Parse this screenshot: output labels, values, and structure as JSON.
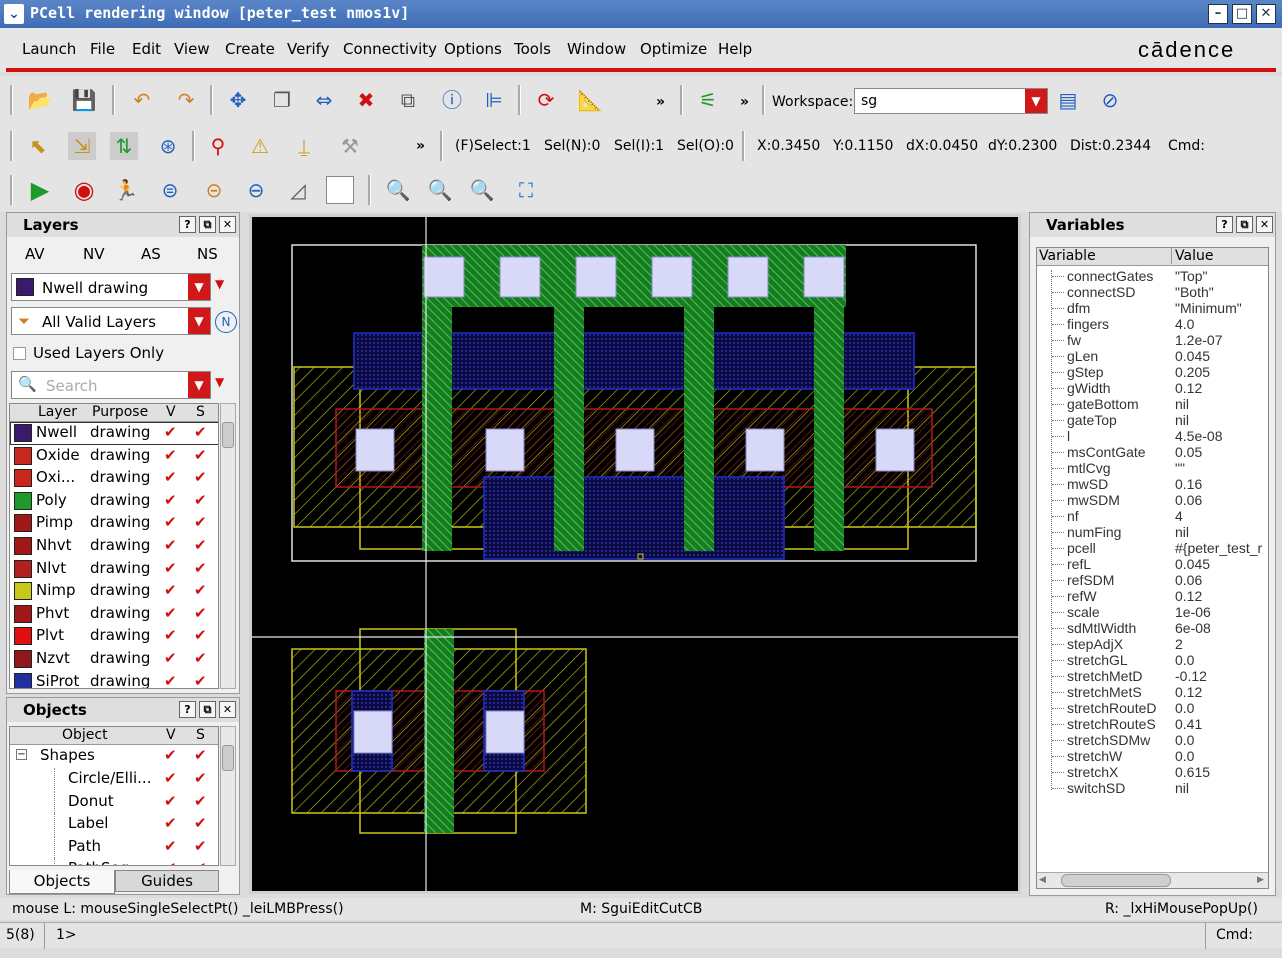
{
  "window": {
    "title": "PCell rendering window [peter_test nmos1v]"
  },
  "menu": [
    "Launch",
    "File",
    "Edit",
    "View",
    "Create",
    "Verify",
    "Connectivity",
    "Options",
    "Tools",
    "Window",
    "Optimize",
    "Help"
  ],
  "brand": "cādence",
  "toolbar": {
    "workspace_label": "Workspace:",
    "workspace_value": "sg",
    "more": "»"
  },
  "status_bar1": {
    "select": "(F)Select:1",
    "sel_n": "Sel(N):0",
    "sel_i": "Sel(I):1",
    "sel_o": "Sel(O):0",
    "x": "X:0.3450",
    "y": "Y:0.1150",
    "dx": "dX:0.0450",
    "dy": "dY:0.2300",
    "dist": "Dist:0.2344",
    "cmd": "Cmd:"
  },
  "layers_panel": {
    "title": "Layers",
    "tabs": [
      "AV",
      "NV",
      "AS",
      "NS"
    ],
    "layer_select": "Nwell drawing",
    "filter_select": "All Valid Layers",
    "used_only": "Used Layers Only",
    "search_placeholder": "Search",
    "columns": [
      "Layer",
      "Purpose",
      "V",
      "S"
    ],
    "rows": [
      {
        "layer": "Nwell",
        "purpose": "drawing",
        "color": "#3a1a6a"
      },
      {
        "layer": "Oxide",
        "purpose": "drawing",
        "color": "#c8281c"
      },
      {
        "layer": "Oxi...",
        "purpose": "drawing",
        "color": "#c8281c"
      },
      {
        "layer": "Poly",
        "purpose": "drawing",
        "color": "#1e9a2a"
      },
      {
        "layer": "Pimp",
        "purpose": "drawing",
        "color": "#a01818"
      },
      {
        "layer": "Nhvt",
        "purpose": "drawing",
        "color": "#a01818"
      },
      {
        "layer": "Nlvt",
        "purpose": "drawing",
        "color": "#b02020"
      },
      {
        "layer": "Nimp",
        "purpose": "drawing",
        "color": "#c8c818"
      },
      {
        "layer": "Phvt",
        "purpose": "drawing",
        "color": "#a01818"
      },
      {
        "layer": "Plvt",
        "purpose": "drawing",
        "color": "#e01010"
      },
      {
        "layer": "Nzvt",
        "purpose": "drawing",
        "color": "#901818"
      },
      {
        "layer": "SiProt",
        "purpose": "drawing",
        "color": "#2030a0"
      }
    ],
    "check": "✔"
  },
  "objects_panel": {
    "title": "Objects",
    "columns": [
      "Object",
      "V",
      "S"
    ],
    "root": "Shapes",
    "items": [
      "Circle/Elli...",
      "Donut",
      "Label",
      "Path",
      "PathSeg"
    ],
    "tabs": [
      "Objects",
      "Guides"
    ]
  },
  "variables_panel": {
    "title": "Variables",
    "columns": [
      "Variable",
      "Value"
    ],
    "rows": [
      {
        "name": "connectGates",
        "value": "\"Top\""
      },
      {
        "name": "connectSD",
        "value": "\"Both\""
      },
      {
        "name": "dfm",
        "value": "\"Minimum\""
      },
      {
        "name": "fingers",
        "value": "4.0"
      },
      {
        "name": "fw",
        "value": "1.2e-07"
      },
      {
        "name": "gLen",
        "value": "0.045"
      },
      {
        "name": "gStep",
        "value": "0.205"
      },
      {
        "name": "gWidth",
        "value": "0.12"
      },
      {
        "name": "gateBottom",
        "value": "nil"
      },
      {
        "name": "gateTop",
        "value": "nil"
      },
      {
        "name": "l",
        "value": "4.5e-08"
      },
      {
        "name": "msContGate",
        "value": "0.05"
      },
      {
        "name": "mtlCvg",
        "value": "\"\""
      },
      {
        "name": "mwSD",
        "value": "0.16"
      },
      {
        "name": "mwSDM",
        "value": "0.06"
      },
      {
        "name": "nf",
        "value": "4"
      },
      {
        "name": "numFing",
        "value": "nil"
      },
      {
        "name": "pcell",
        "value": "#{peter_test_r"
      },
      {
        "name": "refL",
        "value": "0.045"
      },
      {
        "name": "refSDM",
        "value": "0.06"
      },
      {
        "name": "refW",
        "value": "0.12"
      },
      {
        "name": "scale",
        "value": "1e-06"
      },
      {
        "name": "sdMtlWidth",
        "value": "6e-08"
      },
      {
        "name": "stepAdjX",
        "value": "2"
      },
      {
        "name": "stretchGL",
        "value": "0.0"
      },
      {
        "name": "stretchMetD",
        "value": "-0.12"
      },
      {
        "name": "stretchMetS",
        "value": "0.12"
      },
      {
        "name": "stretchRouteD",
        "value": "0.0"
      },
      {
        "name": "stretchRouteS",
        "value": "0.41"
      },
      {
        "name": "stretchSDMw",
        "value": "0.0"
      },
      {
        "name": "stretchW",
        "value": "0.0"
      },
      {
        "name": "stretchX",
        "value": "0.615"
      },
      {
        "name": "switchSD",
        "value": "nil"
      }
    ]
  },
  "bottom": {
    "mouse_l": "mouse L: mouseSingleSelectPt() _leiLMBPress()",
    "mouse_m": "M: SguiEditCutCB",
    "mouse_r": "R: _lxHiMousePopUp()",
    "counter": "5(8)",
    "prompt": "1>",
    "cmd": "Cmd:"
  },
  "colors": {
    "title": "#4a78c0",
    "accent": "#d01010",
    "canvas": "#000000",
    "poly": "#1e9a2a"
  }
}
